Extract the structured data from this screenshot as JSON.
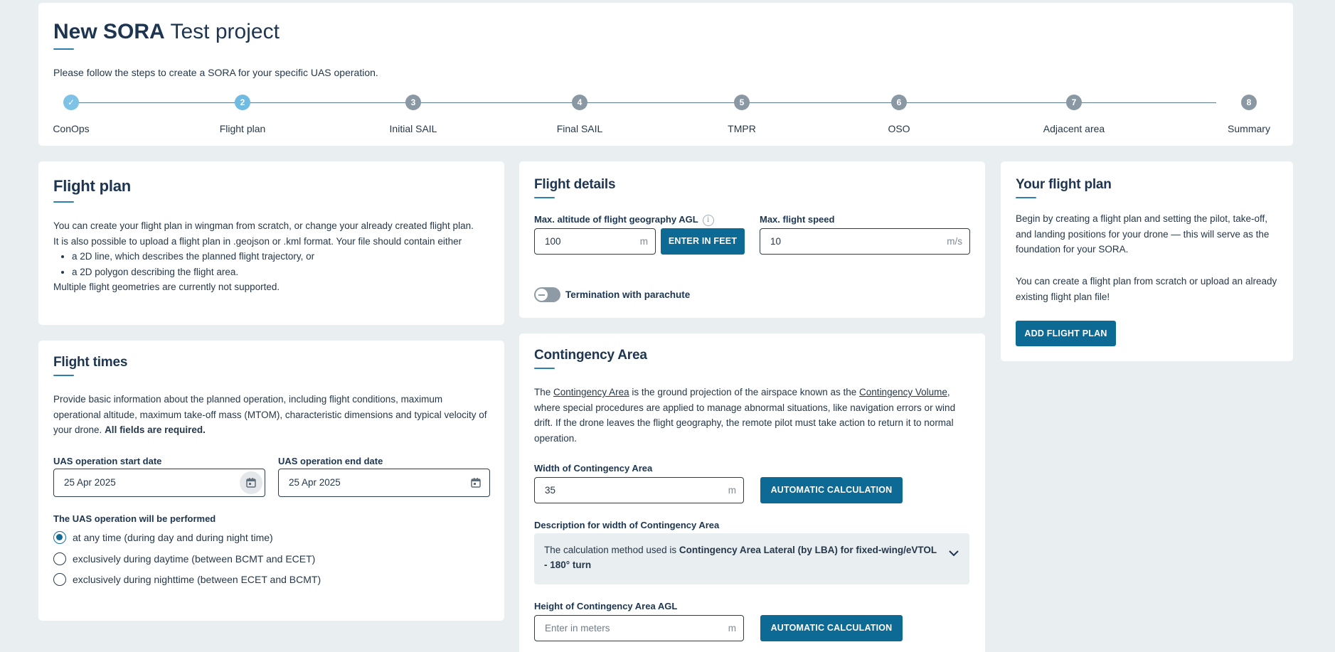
{
  "header": {
    "title_bold": "New SORA",
    "title_rest": "Test project",
    "intro": "Please follow the steps to create a SORA for your specific UAS operation."
  },
  "stepper": {
    "steps": [
      {
        "num": "✓",
        "label": "ConOps",
        "state": "done"
      },
      {
        "num": "2",
        "label": "Flight plan",
        "state": "current"
      },
      {
        "num": "3",
        "label": "Initial SAIL",
        "state": "todo"
      },
      {
        "num": "4",
        "label": "Final SAIL",
        "state": "todo"
      },
      {
        "num": "5",
        "label": "TMPR",
        "state": "todo"
      },
      {
        "num": "6",
        "label": "OSO",
        "state": "todo"
      },
      {
        "num": "7",
        "label": "Adjacent area",
        "state": "todo"
      },
      {
        "num": "8",
        "label": "Summary",
        "state": "todo"
      }
    ]
  },
  "flight_plan": {
    "title": "Flight plan",
    "p1": "You can create your flight plan in wingman from scratch, or change your already created flight plan.",
    "p2": "It is also possible to upload a flight plan in .geojson or .kml format. Your file should contain either",
    "bullet1": "a 2D line, which describes the planned flight trajectory, or",
    "bullet2": "a 2D polygon describing the flight area.",
    "p3": "Multiple flight geometries are currently not supported."
  },
  "flight_times": {
    "title": "Flight times",
    "desc": "Provide basic information about the planned operation, including flight conditions, maximum operational altitude, maximum take-off mass (MTOM), characteristic dimensions and typical velocity of your drone.",
    "desc_bold": "All fields are required.",
    "start_label": "UAS operation start date",
    "start_value": "25 Apr 2025",
    "end_label": "UAS operation end date",
    "end_value": "25 Apr 2025",
    "perform_label": "The UAS operation will be performed",
    "options": [
      "at any time (during day and during night time)",
      "exclusively during daytime (between BCMT and ECET)",
      "exclusively during nighttime (between ECET and BCMT)"
    ]
  },
  "flight_details": {
    "title": "Flight details",
    "altitude_label": "Max. altitude of flight geography AGL",
    "altitude_value": "100",
    "altitude_unit": "m",
    "feet_button": "ENTER IN FEET",
    "speed_label": "Max. flight speed",
    "speed_value": "10",
    "speed_unit": "m/s",
    "parachute_label": "Termination with parachute"
  },
  "contingency": {
    "title": "Contingency Area",
    "d1": "The ",
    "link1": "Contingency Area",
    "d2": " is the ground projection of the airspace known as the ",
    "link2": "Contingency Volume",
    "d3": ", where special procedures are applied to manage abnormal situations, like navigation errors or wind drift. If the drone leaves the flight geography, the remote pilot must take action to return it to normal operation.",
    "width_label": "Width of Contingency Area",
    "width_value": "35",
    "width_unit": "m",
    "auto_calc": "AUTOMATIC CALCULATION",
    "desc_label": "Description for width of Contingency Area",
    "calc_prefix": "The calculation method used is ",
    "calc_bold": "Contingency Area Lateral (by LBA) for fixed-wing/eVTOL - 180° turn",
    "height_label": "Height of Contingency Area AGL",
    "height_placeholder": "Enter in meters",
    "height_unit": "m",
    "auto_calc2": "AUTOMATIC CALCULATION"
  },
  "your_flight_plan": {
    "title": "Your flight plan",
    "p1": "Begin by creating a flight plan and setting the pilot, take-off, and landing positions for your drone — this will serve as the foundation for your SORA.",
    "p2": "You can create a flight plan from scratch or upload an already existing flight plan file!",
    "button": "ADD FLIGHT PLAN"
  }
}
